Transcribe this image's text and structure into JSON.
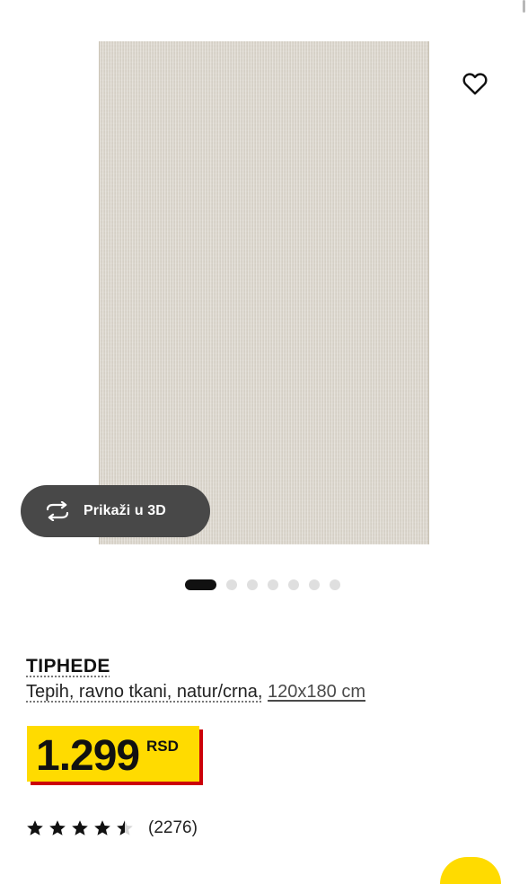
{
  "gallery": {
    "favorite_icon": "heart-icon",
    "view3d": {
      "label": "Prikaži u 3D",
      "icon": "rotate-3d-icon"
    },
    "carousel": {
      "total": 7,
      "active_index": 0
    }
  },
  "product": {
    "name": "TIPHEDE",
    "type": "Tepih, ravno tkani, natur/crna,",
    "size": "120x180 cm"
  },
  "price": {
    "value": "1.299",
    "currency": "RSD"
  },
  "rating": {
    "score": 4.5,
    "max": 5,
    "count": "(2276)"
  },
  "colors": {
    "price_bg": "#ffdb00",
    "price_shadow": "#cc0008",
    "button_bg": "#484848",
    "text": "#111111"
  }
}
